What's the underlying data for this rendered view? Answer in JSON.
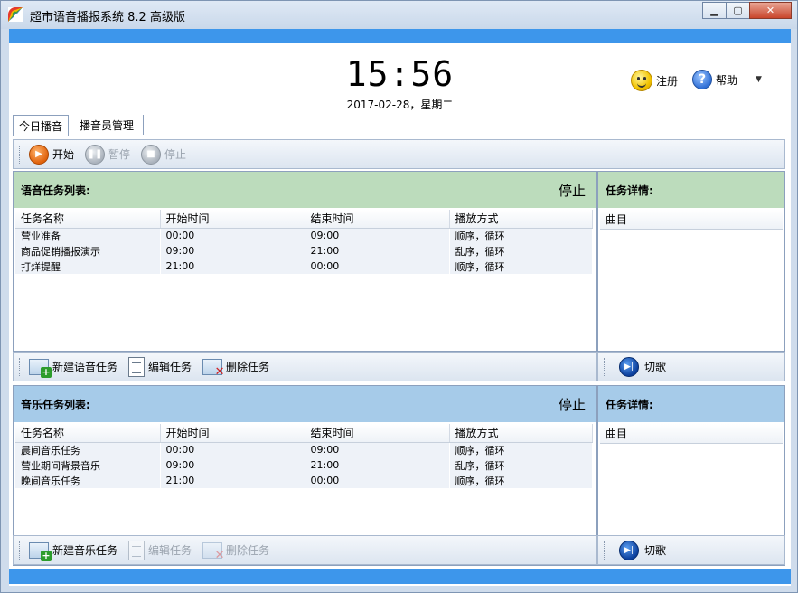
{
  "window": {
    "title": "超市语音播报系统 8.2 高级版",
    "minimize_icon": "minimize-icon",
    "maximize_icon": "maximize-icon",
    "close_icon": "close-icon"
  },
  "header": {
    "time": "15:56",
    "date": "2017-02-28，星期二",
    "register_label": "注册",
    "help_label": "帮助"
  },
  "tabs": [
    {
      "label": "今日播音",
      "active": true
    },
    {
      "label": "播音员管理",
      "active": false
    }
  ],
  "toolbar": {
    "start_label": "开始",
    "pause_label": "暂停",
    "stop_label": "停止"
  },
  "voice_tasks": {
    "title": "语音任务列表:",
    "status": "停止",
    "columns": [
      "任务名称",
      "开始时间",
      "结束时间",
      "播放方式"
    ],
    "rows": [
      [
        "营业准备",
        "00:00",
        "09:00",
        "顺序，循环"
      ],
      [
        "商品促销播报演示",
        "09:00",
        "21:00",
        "乱序，循环"
      ],
      [
        "打烊提醒",
        "21:00",
        "00:00",
        "顺序，循环"
      ]
    ],
    "detail_title": "任务详情:",
    "detail_column": "曲目",
    "actions": {
      "new_label": "新建语音任务",
      "edit_label": "编辑任务",
      "delete_label": "删除任务",
      "skip_label": "切歌"
    }
  },
  "music_tasks": {
    "title": "音乐任务列表:",
    "status": "停止",
    "columns": [
      "任务名称",
      "开始时间",
      "结束时间",
      "播放方式"
    ],
    "rows": [
      [
        "晨间音乐任务",
        "00:00",
        "09:00",
        "顺序，循环"
      ],
      [
        "营业期间背景音乐",
        "09:00",
        "21:00",
        "乱序，循环"
      ],
      [
        "晚间音乐任务",
        "21:00",
        "00:00",
        "顺序，循环"
      ]
    ],
    "detail_title": "任务详情:",
    "detail_column": "曲目",
    "actions": {
      "new_label": "新建音乐任务",
      "edit_label": "编辑任务",
      "delete_label": "删除任务",
      "skip_label": "切歌"
    }
  },
  "colors": {
    "accent_bar": "#3d96eb",
    "voice_header": "#bcdcbc",
    "music_header": "#a6cbe9"
  }
}
